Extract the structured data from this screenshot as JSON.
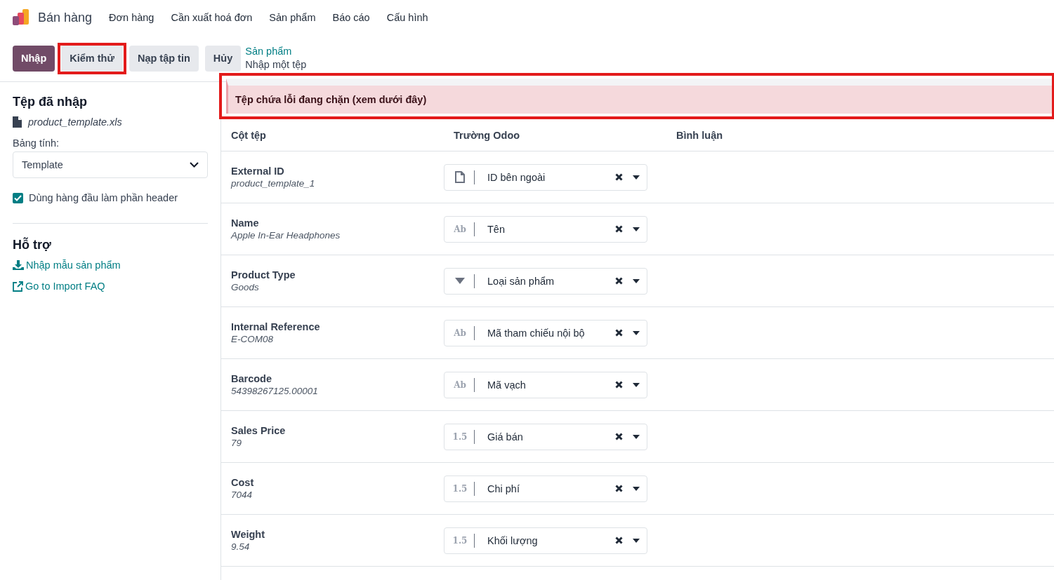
{
  "app_menu": {
    "app_name": "Bán hàng",
    "items": [
      "Đơn hàng",
      "Cần xuất hoá đơn",
      "Sản phẩm",
      "Báo cáo",
      "Cấu hình"
    ]
  },
  "actions": [
    {
      "label": "Nhập",
      "kind": "primary",
      "highlighted": false
    },
    {
      "label": "Kiểm thử",
      "kind": "secondary",
      "highlighted": true
    },
    {
      "label": "Nạp tập tin",
      "kind": "secondary",
      "highlighted": false
    },
    {
      "label": "Hủy",
      "kind": "secondary",
      "highlighted": false
    }
  ],
  "breadcrumb": {
    "parent": "Sản phẩm",
    "current": "Nhập một tệp"
  },
  "sidebar": {
    "imported_title": "Tệp đã nhập",
    "file_name": "product_template.xls",
    "sheet_label": "Bảng tính:",
    "sheet_value": "Template",
    "header_option": {
      "label": "Dùng hàng đầu làm phần header",
      "checked": true
    },
    "help_title": "Hỗ trợ",
    "links": [
      {
        "label": "Nhập mẫu sản phẩm",
        "kind": "download"
      },
      {
        "label": "Go to Import FAQ",
        "kind": "external"
      }
    ]
  },
  "alert": {
    "text": "Tệp chứa lỗi đang chặn (xem dưới đây)",
    "highlighted": true
  },
  "table": {
    "columns": [
      "Cột tệp",
      "Trường Odoo",
      "Bình luận"
    ],
    "rows": [
      {
        "column": "External ID",
        "sample": "product_template_1",
        "field": "ID bên ngoài",
        "kind": "id"
      },
      {
        "column": "Name",
        "sample": "Apple In-Ear Headphones",
        "field": "Tên",
        "kind": "text",
        "type_icon": "Ab"
      },
      {
        "column": "Product Type",
        "sample": "Goods",
        "field": "Loại sản phẩm",
        "kind": "selection"
      },
      {
        "column": "Internal Reference",
        "sample": "E-COM08",
        "field": "Mã tham chiếu nội bộ",
        "kind": "text",
        "type_icon": "Ab"
      },
      {
        "column": "Barcode",
        "sample": "54398267125.00001",
        "field": "Mã vạch",
        "kind": "text",
        "type_icon": "Ab"
      },
      {
        "column": "Sales Price",
        "sample": "79",
        "field": "Giá bán",
        "kind": "float",
        "type_icon": "1.5"
      },
      {
        "column": "Cost",
        "sample": "7044",
        "field": "Chi phí",
        "kind": "float",
        "type_icon": "1.5"
      },
      {
        "column": "Weight",
        "sample": "9.54",
        "field": "Khối lượng",
        "kind": "float",
        "type_icon": "1.5"
      }
    ]
  }
}
